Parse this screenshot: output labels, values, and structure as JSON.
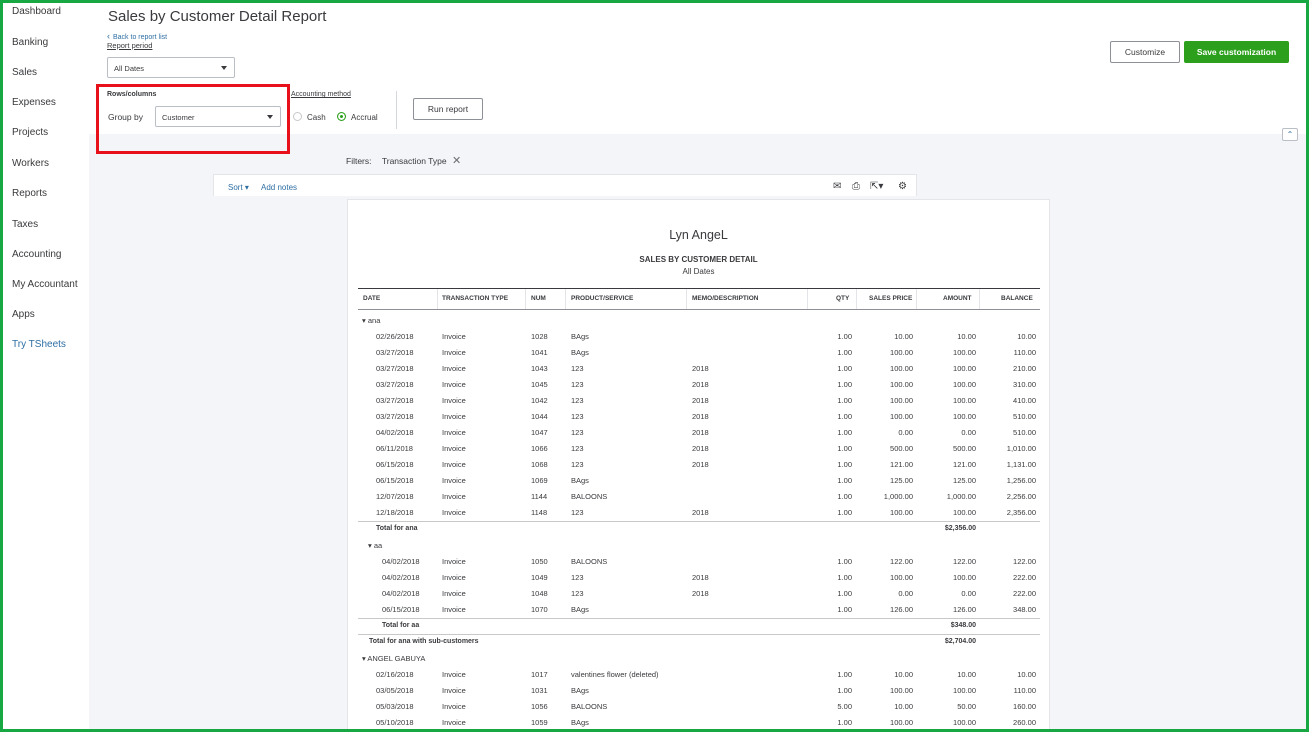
{
  "sidebar": {
    "items": [
      "Dashboard",
      "Banking",
      "Sales",
      "Expenses",
      "Projects",
      "Workers",
      "Reports",
      "Taxes",
      "Accounting",
      "My Accountant",
      "Apps",
      "Try TSheets"
    ]
  },
  "header": {
    "title": "Sales by Customer Detail Report",
    "back_link": "Back to report list",
    "report_period_label": "Report period",
    "report_period_value": "All Dates",
    "rows_columns_label": "Rows/columns",
    "group_by_label": "Group by",
    "group_by_value": "Customer",
    "accounting_method_label": "Accounting method",
    "method_cash": "Cash",
    "method_accrual": "Accrual",
    "selected_method": "Accrual",
    "run_report": "Run report",
    "customize": "Customize",
    "save_customization": "Save customization"
  },
  "filters": {
    "label": "Filters:",
    "chip": "Transaction Type"
  },
  "toolbar": {
    "sort": "Sort",
    "add_notes": "Add notes",
    "icons": [
      "email-icon",
      "print-icon",
      "export-icon",
      "gear-icon"
    ]
  },
  "report": {
    "company": "Lyn AngeL",
    "title": "SALES BY CUSTOMER DETAIL",
    "subtitle": "All Dates",
    "columns": [
      "DATE",
      "TRANSACTION TYPE",
      "NUM",
      "PRODUCT/SERVICE",
      "MEMO/DESCRIPTION",
      "QTY",
      "SALES PRICE",
      "AMOUNT",
      "BALANCE"
    ],
    "groups": [
      {
        "name": "ana",
        "rows": [
          [
            "02/26/2018",
            "Invoice",
            "1028",
            "BAgs",
            "",
            "1.00",
            "10.00",
            "10.00",
            "10.00"
          ],
          [
            "03/27/2018",
            "Invoice",
            "1041",
            "BAgs",
            "",
            "1.00",
            "100.00",
            "100.00",
            "110.00"
          ],
          [
            "03/27/2018",
            "Invoice",
            "1043",
            "123",
            "2018",
            "1.00",
            "100.00",
            "100.00",
            "210.00"
          ],
          [
            "03/27/2018",
            "Invoice",
            "1045",
            "123",
            "2018",
            "1.00",
            "100.00",
            "100.00",
            "310.00"
          ],
          [
            "03/27/2018",
            "Invoice",
            "1042",
            "123",
            "2018",
            "1.00",
            "100.00",
            "100.00",
            "410.00"
          ],
          [
            "03/27/2018",
            "Invoice",
            "1044",
            "123",
            "2018",
            "1.00",
            "100.00",
            "100.00",
            "510.00"
          ],
          [
            "04/02/2018",
            "Invoice",
            "1047",
            "123",
            "2018",
            "1.00",
            "0.00",
            "0.00",
            "510.00"
          ],
          [
            "06/11/2018",
            "Invoice",
            "1066",
            "123",
            "2018",
            "1.00",
            "500.00",
            "500.00",
            "1,010.00"
          ],
          [
            "06/15/2018",
            "Invoice",
            "1068",
            "123",
            "2018",
            "1.00",
            "121.00",
            "121.00",
            "1,131.00"
          ],
          [
            "06/15/2018",
            "Invoice",
            "1069",
            "BAgs",
            "",
            "1.00",
            "125.00",
            "125.00",
            "1,256.00"
          ],
          [
            "12/07/2018",
            "Invoice",
            "1144",
            "BALOONS",
            "",
            "1.00",
            "1,000.00",
            "1,000.00",
            "2,256.00"
          ],
          [
            "12/18/2018",
            "Invoice",
            "1148",
            "123",
            "2018",
            "1.00",
            "100.00",
            "100.00",
            "2,356.00"
          ]
        ],
        "total_label": "Total for ana",
        "total_amount": "$2,356.00"
      },
      {
        "name": "aa",
        "rows": [
          [
            "04/02/2018",
            "Invoice",
            "1050",
            "BALOONS",
            "",
            "1.00",
            "122.00",
            "122.00",
            "122.00"
          ],
          [
            "04/02/2018",
            "Invoice",
            "1049",
            "123",
            "2018",
            "1.00",
            "100.00",
            "100.00",
            "222.00"
          ],
          [
            "04/02/2018",
            "Invoice",
            "1048",
            "123",
            "2018",
            "1.00",
            "0.00",
            "0.00",
            "222.00"
          ],
          [
            "06/15/2018",
            "Invoice",
            "1070",
            "BAgs",
            "",
            "1.00",
            "126.00",
            "126.00",
            "348.00"
          ]
        ],
        "total_label": "Total for aa",
        "total_amount": "$348.00"
      }
    ],
    "subcustomer_total_label": "Total for ana with sub-customers",
    "subcustomer_total_amount": "$2,704.00",
    "group3": {
      "name": "ANGEL GABUYA",
      "rows": [
        [
          "02/16/2018",
          "Invoice",
          "1017",
          "valentines flower (deleted)",
          "",
          "1.00",
          "10.00",
          "10.00",
          "10.00"
        ],
        [
          "03/05/2018",
          "Invoice",
          "1031",
          "BAgs",
          "",
          "1.00",
          "100.00",
          "100.00",
          "110.00"
        ],
        [
          "05/03/2018",
          "Invoice",
          "1056",
          "BALOONS",
          "",
          "5.00",
          "10.00",
          "50.00",
          "160.00"
        ],
        [
          "05/10/2018",
          "Invoice",
          "1059",
          "BAgs",
          "",
          "1.00",
          "100.00",
          "100.00",
          "260.00"
        ]
      ]
    }
  },
  "colors": {
    "frame": "#18a843",
    "accent_green": "#2ca01c",
    "highlight_red": "#e8101a",
    "link_blue": "#2f6fa4"
  }
}
